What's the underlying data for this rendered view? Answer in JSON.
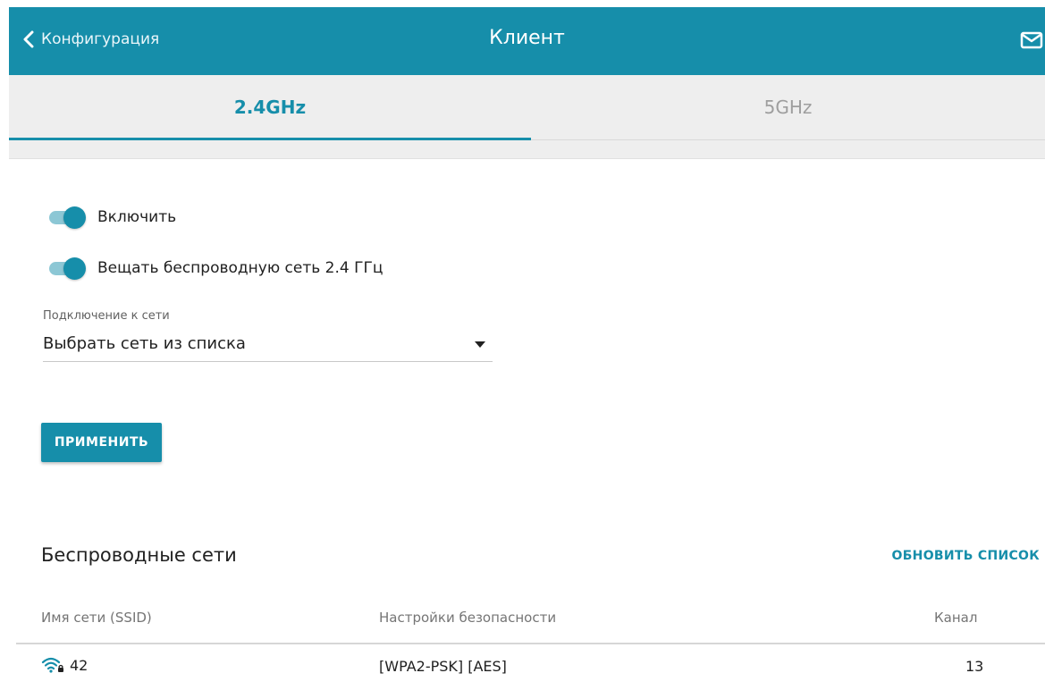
{
  "header": {
    "back_label": "Конфигурация",
    "title": "Клиент",
    "mail_icon": "mail-icon",
    "background": "#168eaa"
  },
  "tabs": [
    {
      "label": "2.4GHz",
      "active": true
    },
    {
      "label": "5GHz",
      "active": false
    }
  ],
  "settings": {
    "enable_label": "Включить",
    "enable_on": true,
    "broadcast_label": "Вещать беспроводную сеть 2.4 ГГц",
    "broadcast_on": true,
    "connection_label": "Подключение к сети",
    "connection_value": "Выбрать сеть из списка",
    "apply_label": "ПРИМЕНИТЬ"
  },
  "wireless": {
    "title": "Беспроводные сети",
    "refresh_label": "ОБНОВИТЬ СПИСОК",
    "columns": [
      "Имя сети (SSID)",
      "Настройки безопасности",
      "Канал"
    ],
    "rows": [
      {
        "ssid": "42",
        "security": "[WPA2-PSK] [AES]",
        "channel": "13",
        "icon": "wifi-lock-icon"
      }
    ]
  },
  "colors": {
    "accent": "#168eaa",
    "tab_bg": "#eeeeee",
    "toggle_track": "#8cc7d5"
  }
}
